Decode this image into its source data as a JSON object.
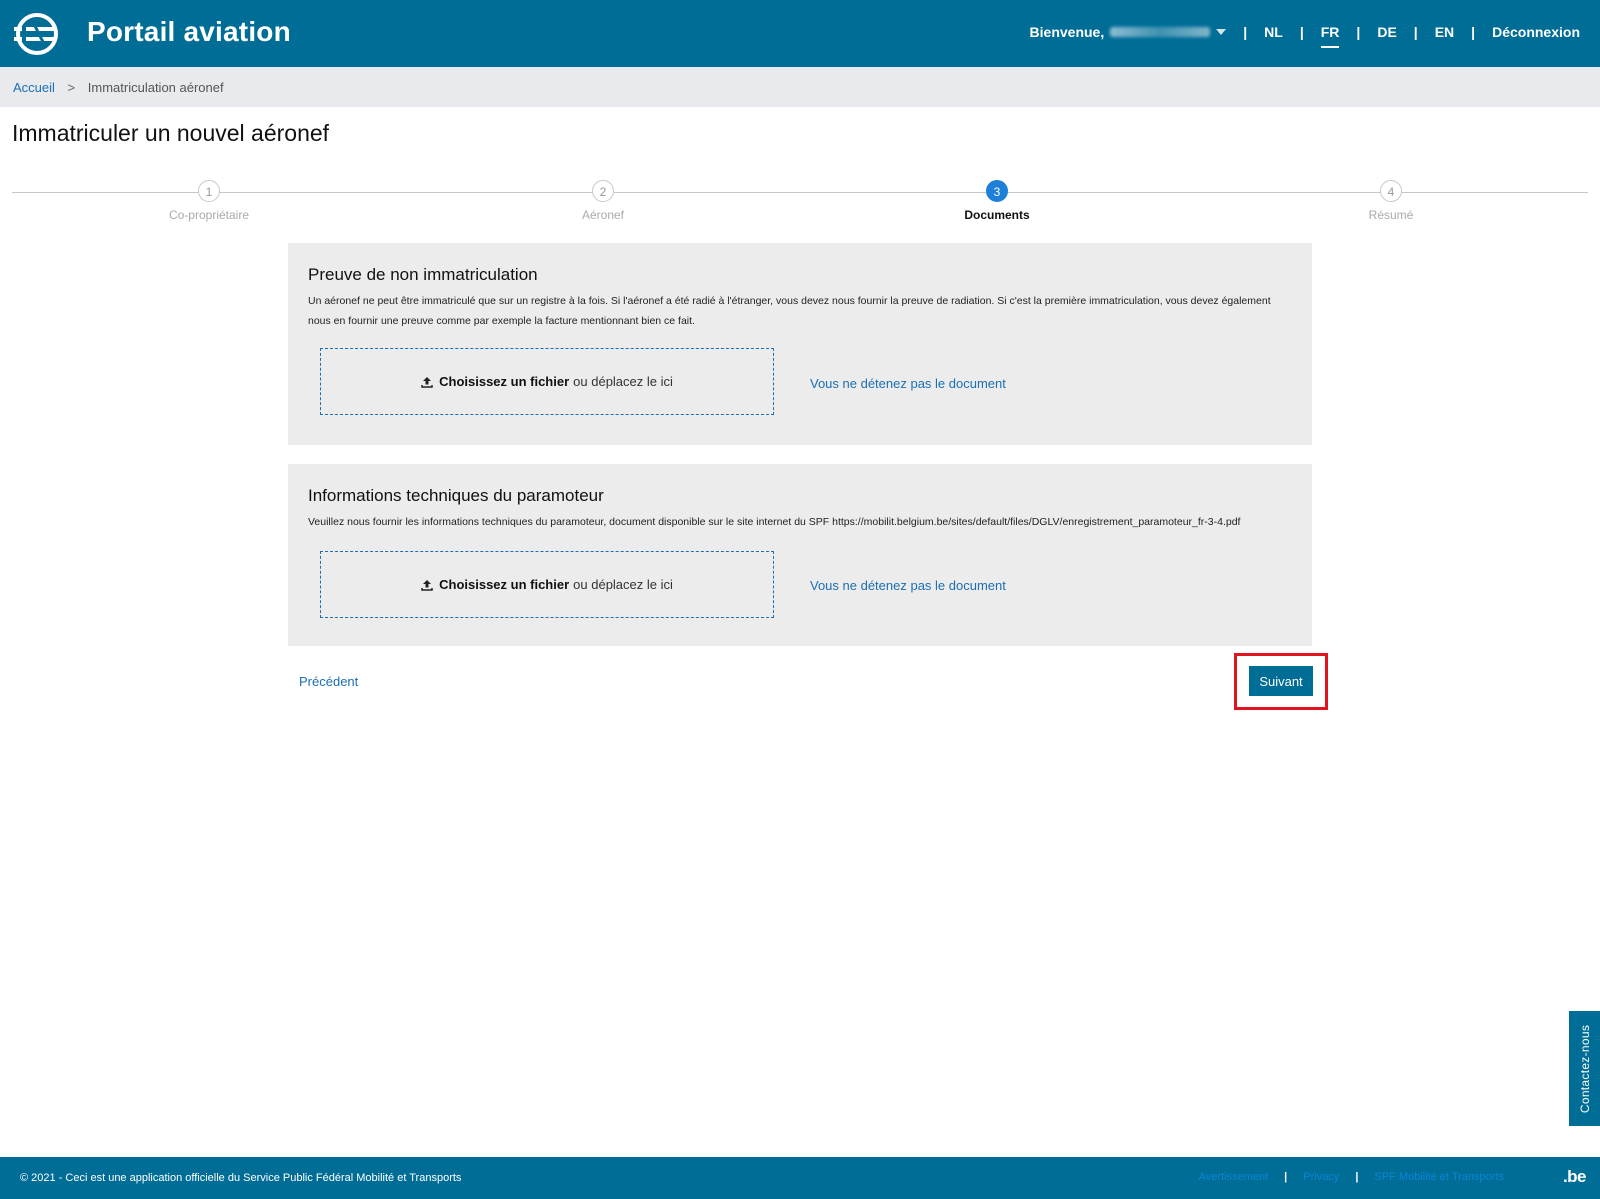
{
  "header": {
    "app_title": "Portail aviation",
    "welcome_label": "Bienvenue,",
    "languages": [
      "NL",
      "FR",
      "DE",
      "EN"
    ],
    "active_language": "FR",
    "logout_label": "Déconnexion"
  },
  "breadcrumb": {
    "home": "Accueil",
    "separator": ">",
    "current": "Immatriculation aéronef"
  },
  "page_title": "Immatriculer un nouvel aéronef",
  "stepper": {
    "steps": [
      {
        "number": "1",
        "label": "Co-propriétaire"
      },
      {
        "number": "2",
        "label": "Aéronef"
      },
      {
        "number": "3",
        "label": "Documents"
      },
      {
        "number": "4",
        "label": "Résumé"
      }
    ],
    "active_step": 3
  },
  "sections": [
    {
      "title": "Preuve de non immatriculation",
      "description": "Un aéronef ne peut être immatriculé que sur un registre à la fois. Si l'aéronef a été radié à l'étranger, vous devez nous fournir la preuve de radiation. Si c'est la première immatriculation, vous devez également nous en fournir une preuve comme par exemple la facture mentionnant bien ce fait.",
      "upload_strong": "Choisissez un fichier",
      "upload_rest": "ou déplacez le ici",
      "no_document": "Vous ne détenez pas le document"
    },
    {
      "title": "Informations techniques du paramoteur",
      "description": "Veuillez nous fournir les informations techniques du paramoteur, document disponible sur le site internet du SPF https://mobilit.belgium.be/sites/default/files/DGLV/enregistrement_paramoteur_fr-3-4.pdf",
      "upload_strong": "Choisissez un fichier",
      "upload_rest": "ou déplacez le ici",
      "no_document": "Vous ne détenez pas le document"
    }
  ],
  "actions": {
    "previous": "Précédent",
    "next": "Suivant"
  },
  "contact_tab": "Contactez-nous",
  "footer": {
    "copyright": "© 2021 - Ceci est une application officielle du Service Public Fédéral Mobilité et Transports",
    "links": [
      "Avertissement",
      "Privacy",
      "SPF Mobilité et Transports"
    ],
    "be_logo": ".be"
  },
  "colors": {
    "brand": "#006d97",
    "link": "#1b6fb5",
    "active_step": "#1e7fd8",
    "highlight": "#e0141e"
  },
  "icons": {
    "upload": "upload-icon",
    "dropdown": "caret-down-icon",
    "logo": "portal-logo-icon"
  }
}
